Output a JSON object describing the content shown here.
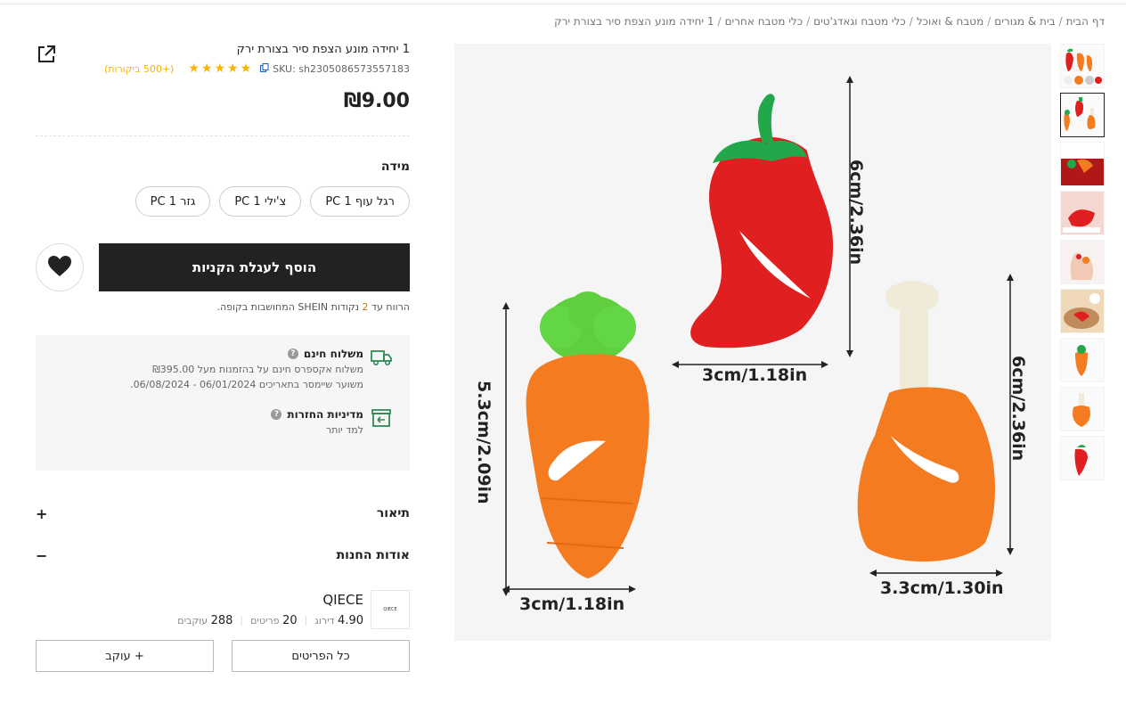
{
  "breadcrumb": {
    "items": [
      "דף הבית",
      "בית & מגורים",
      "מטבח & ואוכל",
      "כלי מטבח וגאדג'טים",
      "כלי מטבח אחרים",
      "1 יחידה מונע הצפת סיר בצורת ירק"
    ],
    "separator": "/"
  },
  "product": {
    "title": "1 יחידה מונע הצפת סיר בצורת ירק",
    "sku": "SKU: sh2305086573557183",
    "rating_stars": 5,
    "reviews": "(+500 ביקורות)",
    "price": "₪9.00",
    "size_label": "מידה",
    "sizes": [
      "רגל עוף 1 PC",
      "צ'ילי 1 PC",
      "גזר 1 PC"
    ],
    "add_to_cart": "הוסף לעגלת הקניות",
    "points_prefix": "הרווח עד",
    "points_value": "2",
    "points_suffix": "נקודות SHEIN המחושבות בקופה."
  },
  "shipping": {
    "title": "משלוח חינם",
    "line1": "משלוח אקספרס חינם על בהזמנות מעל ₪395.00",
    "line2": "משוער שיימסר בתאריכים 06/01/2024 - 06/08/2024.",
    "returns_title": "מדיניות החזרות",
    "returns_link": "למד יותר"
  },
  "accordion": {
    "description": "תיאור",
    "description_sign": "+",
    "about_store": "אודות החנות",
    "about_store_sign": "−"
  },
  "store": {
    "logo_text": "QIECE",
    "name": "QIECE",
    "rating": "4.90",
    "rating_label": "דירוג",
    "items_count": "20",
    "items_label": "פריטים",
    "followers": "288",
    "followers_label": "עוקבים",
    "all_items_button": "כל הפריטים",
    "follow_button": "+ עוקב"
  },
  "image_labels": {
    "chili_height": "6cm/2.36in",
    "chili_width": "3cm/1.18in",
    "carrot_height": "5.3cm/2.09in",
    "carrot_width": "3cm/1.18in",
    "drumstick_height": "6cm/2.36in",
    "drumstick_width": "3.3cm/1.30in"
  },
  "colors": {
    "accent_dark": "#222222",
    "star": "#f7b500",
    "shipping_green": "#2e8b57",
    "carrot": "#f47b20",
    "chili": "#e02020",
    "leaf": "#22a84a"
  }
}
